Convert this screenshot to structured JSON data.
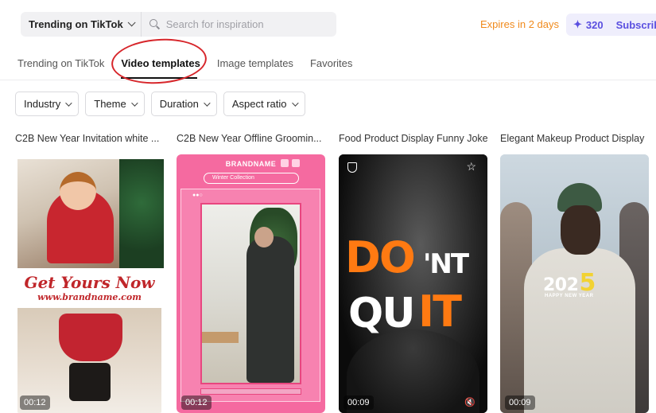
{
  "search": {
    "source_label": "Trending on TikTok",
    "placeholder": "Search for inspiration"
  },
  "header": {
    "expires": "Expires in 2 days",
    "credits": "320",
    "subscribe": "Subscrib"
  },
  "tabs": [
    {
      "label": "Trending on TikTok",
      "active": false
    },
    {
      "label": "Video templates",
      "active": true
    },
    {
      "label": "Image templates",
      "active": false
    },
    {
      "label": "Favorites",
      "active": false
    }
  ],
  "filters": [
    {
      "label": "Industry"
    },
    {
      "label": "Theme"
    },
    {
      "label": "Duration"
    },
    {
      "label": "Aspect ratio"
    }
  ],
  "cards": [
    {
      "title": "C2B New Year Invitation white ...",
      "duration": "00:12",
      "overlay_big": "Get Yours Now",
      "overlay_url": "www.brandname.com"
    },
    {
      "title": "C2B New Year Offline Groomin...",
      "duration": "00:12",
      "brand": "BRANDNAME",
      "search_text": "Winter Collection"
    },
    {
      "title": "Food Product Display Funny Joke",
      "duration": "00:09",
      "words": [
        "DO",
        "'NT",
        "QU",
        "IT"
      ]
    },
    {
      "title": "Elegant Makeup Product Display",
      "duration": "00:09",
      "year_prefix": "202",
      "year_last": "5",
      "subtitle": "HAPPY NEW YEAR"
    }
  ],
  "colors": {
    "accent_orange": "#f08a1c",
    "credits_purple": "#5a4fe0",
    "annotation_red": "#d7262b"
  }
}
